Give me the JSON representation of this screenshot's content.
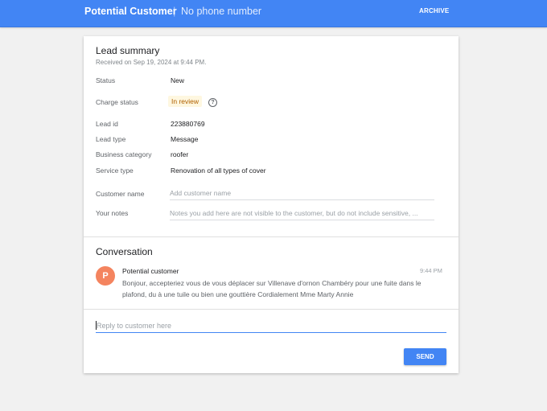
{
  "header": {
    "title": "Potential Customer",
    "separator": "|",
    "phone": "No phone number",
    "archive_label": "ARCHIVE"
  },
  "summary": {
    "title": "Lead summary",
    "received": "Received on Sep 19, 2024 at 9:44 PM.",
    "status_label": "Status",
    "status_value": "New",
    "charge_label": "Charge status",
    "charge_value": "In review",
    "lead_id_label": "Lead id",
    "lead_id_value": "223880769",
    "lead_type_label": "Lead type",
    "lead_type_value": "Message",
    "category_label": "Business category",
    "category_value": "roofer",
    "service_label": "Service type",
    "service_value": "Renovation of all types of cover",
    "customer_name_label": "Customer name",
    "customer_name_placeholder": "Add customer name",
    "notes_label": "Your notes",
    "notes_placeholder": "Notes you add here are not visible to the customer, but do not include sensitive, ..."
  },
  "conversation": {
    "title": "Conversation",
    "avatar_letter": "P",
    "sender": "Potential customer",
    "time": "9:44 PM",
    "message": "Bonjour, accepteriez vous de vous déplacer sur Villenave d'ornon Chambéry pour une fuite dans le plafond, du à une tuile ou bien une gouttière Cordialement Mme Marty Annie"
  },
  "reply": {
    "placeholder": "Reply to customer here",
    "send_label": "SEND"
  },
  "colors": {
    "brand": "#4285f4",
    "avatar": "#f4845f",
    "badge_bg": "#fef7e0",
    "badge_text": "#b06000"
  }
}
